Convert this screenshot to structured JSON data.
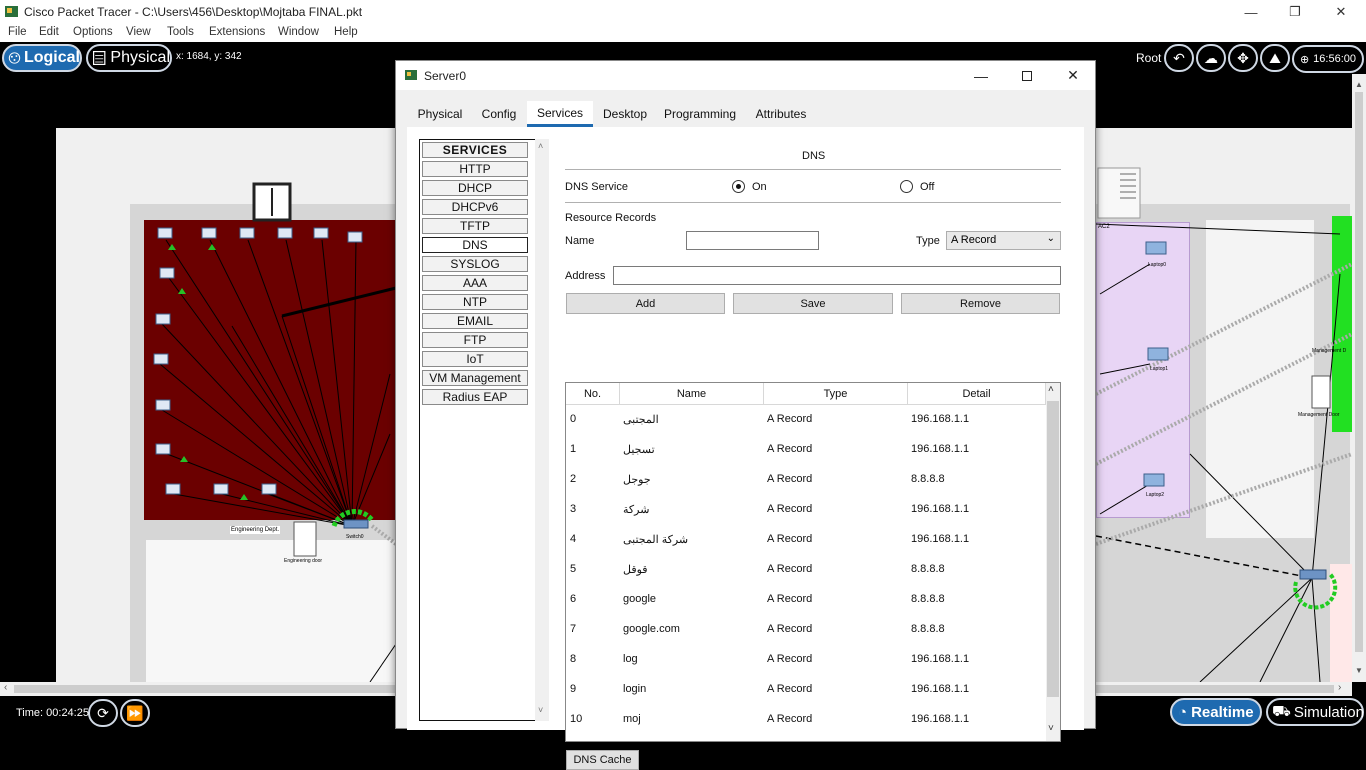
{
  "window": {
    "title": "Cisco Packet Tracer - C:\\Users\\456\\Desktop\\Mojtaba FINAL.pkt",
    "min": "—",
    "max": "❐",
    "close": "✕"
  },
  "menu": [
    "File",
    "Edit",
    "Options",
    "View",
    "Tools",
    "Extensions",
    "Window",
    "Help"
  ],
  "modebar": {
    "logical": "Logical",
    "physical": "Physical",
    "coords": "x: 1684, y: 342",
    "root": "Root",
    "clock": "16:56:00"
  },
  "workspace_labels": {
    "eng_dept": "Engineering Dept.",
    "switch0": "Switch0",
    "eng_door": "Engineering door",
    "ac2": "AC2",
    "laptop0": "Laptop0",
    "laptop1": "Laptop1",
    "laptop2": "Laptop2",
    "mgmt_door": "Management Door",
    "mgmt": "Management D"
  },
  "bottom": {
    "time": "Time: 00:24:25",
    "realtime": "Realtime",
    "simulation": "Simulation"
  },
  "dialog": {
    "title": "Server0",
    "tabs": [
      "Physical",
      "Config",
      "Services",
      "Desktop",
      "Programming",
      "Attributes"
    ],
    "active_tab": "Services",
    "services": [
      "SERVICES",
      "HTTP",
      "DHCP",
      "DHCPv6",
      "TFTP",
      "DNS",
      "SYSLOG",
      "AAA",
      "NTP",
      "EMAIL",
      "FTP",
      "IoT",
      "VM Management",
      "Radius EAP"
    ],
    "selected_service": "DNS",
    "dns": {
      "heading": "DNS",
      "service_label": "DNS Service",
      "on_label": "On",
      "off_label": "Off",
      "service_state": "On",
      "resource_records": "Resource Records",
      "name_label": "Name",
      "name_value": "",
      "type_label": "Type",
      "type_value": "A Record",
      "address_label": "Address",
      "address_value": "",
      "add": "Add",
      "save": "Save",
      "remove": "Remove",
      "columns": [
        "No.",
        "Name",
        "Type",
        "Detail"
      ],
      "records": [
        {
          "no": "0",
          "name": "المجتبى",
          "type": "A Record",
          "detail": "196.168.1.1"
        },
        {
          "no": "1",
          "name": "تسجيل",
          "type": "A Record",
          "detail": "196.168.1.1"
        },
        {
          "no": "2",
          "name": "جوجل",
          "type": "A Record",
          "detail": "8.8.8.8"
        },
        {
          "no": "3",
          "name": "شركة",
          "type": "A Record",
          "detail": "196.168.1.1"
        },
        {
          "no": "4",
          "name": "شركة المجتبى",
          "type": "A Record",
          "detail": "196.168.1.1"
        },
        {
          "no": "5",
          "name": "قوقل",
          "type": "A Record",
          "detail": "8.8.8.8"
        },
        {
          "no": "6",
          "name": "google",
          "type": "A Record",
          "detail": "8.8.8.8"
        },
        {
          "no": "7",
          "name": "google.com",
          "type": "A Record",
          "detail": "8.8.8.8"
        },
        {
          "no": "8",
          "name": "log",
          "type": "A Record",
          "detail": "196.168.1.1"
        },
        {
          "no": "9",
          "name": "login",
          "type": "A Record",
          "detail": "196.168.1.1"
        },
        {
          "no": "10",
          "name": "moj",
          "type": "A Record",
          "detail": "196.168.1.1"
        }
      ],
      "dns_cache": "DNS Cache"
    }
  },
  "colors": {
    "accent": "#1e6ab0",
    "red_room": "#6b0000",
    "purple_room": "#e8d5f5",
    "green_room": "#22e022"
  }
}
